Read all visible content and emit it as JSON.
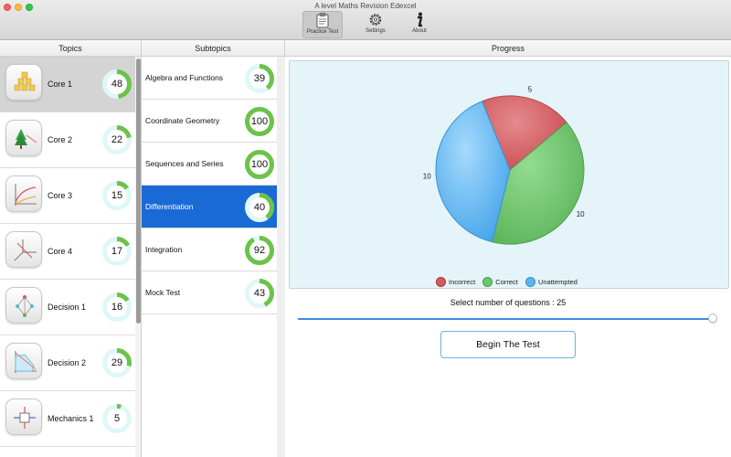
{
  "window": {
    "title": "A level Maths Revision Edexcel"
  },
  "toolbar": {
    "practice_label": "Practice Test",
    "settings_label": "Settings",
    "about_label": "About",
    "practice_icon": "clipboard-icon",
    "settings_icon": "gear-icon",
    "about_icon": "info-icon"
  },
  "headers": {
    "topics": "Topics",
    "subtopics": "Subtopics",
    "progress": "Progress"
  },
  "topics": [
    {
      "label": "Core 1",
      "progress": 48,
      "icon": "pyramid-blocks-icon",
      "selected": true
    },
    {
      "label": "Core 2",
      "progress": 22,
      "icon": "tree-graph-icon",
      "selected": false
    },
    {
      "label": "Core 3",
      "progress": 15,
      "icon": "curve-graph-icon",
      "selected": false
    },
    {
      "label": "Core 4",
      "progress": 17,
      "icon": "3d-axes-icon",
      "selected": false
    },
    {
      "label": "Decision 1",
      "progress": 16,
      "icon": "network-graph-icon",
      "selected": false
    },
    {
      "label": "Decision 2",
      "progress": 29,
      "icon": "linear-programming-icon",
      "selected": false
    },
    {
      "label": "Mechanics 1",
      "progress": 5,
      "icon": "forces-icon",
      "selected": false
    }
  ],
  "subtopics": [
    {
      "label": "Algebra and Functions",
      "progress": 39,
      "selected": false
    },
    {
      "label": "Coordinate Geometry",
      "progress": 100,
      "selected": false
    },
    {
      "label": "Sequences and Series",
      "progress": 100,
      "selected": false
    },
    {
      "label": "Differentiation",
      "progress": 40,
      "selected": true
    },
    {
      "label": "Integration",
      "progress": 92,
      "selected": false
    },
    {
      "label": "Mock Test",
      "progress": 43,
      "selected": false
    }
  ],
  "colors": {
    "ring_fill": "#6cc24a",
    "ring_track": "#e0f7f7",
    "selected_row": "#1a6ad6",
    "incorrect": "#d45a5f",
    "correct": "#6cc56c",
    "unattempted": "#5ab4f0"
  },
  "chart_data": {
    "type": "pie",
    "categories": [
      "Incorrect",
      "Correct",
      "Unattempted"
    ],
    "values": [
      5,
      10,
      10
    ],
    "legend": "bottom",
    "colors": [
      "#d45a5f",
      "#6cc56c",
      "#5ab4f0"
    ]
  },
  "questions": {
    "label": "Select number of questions : 25",
    "value": 25,
    "slider_fraction": 1.0
  },
  "begin_button": {
    "label": "Begin The Test"
  }
}
